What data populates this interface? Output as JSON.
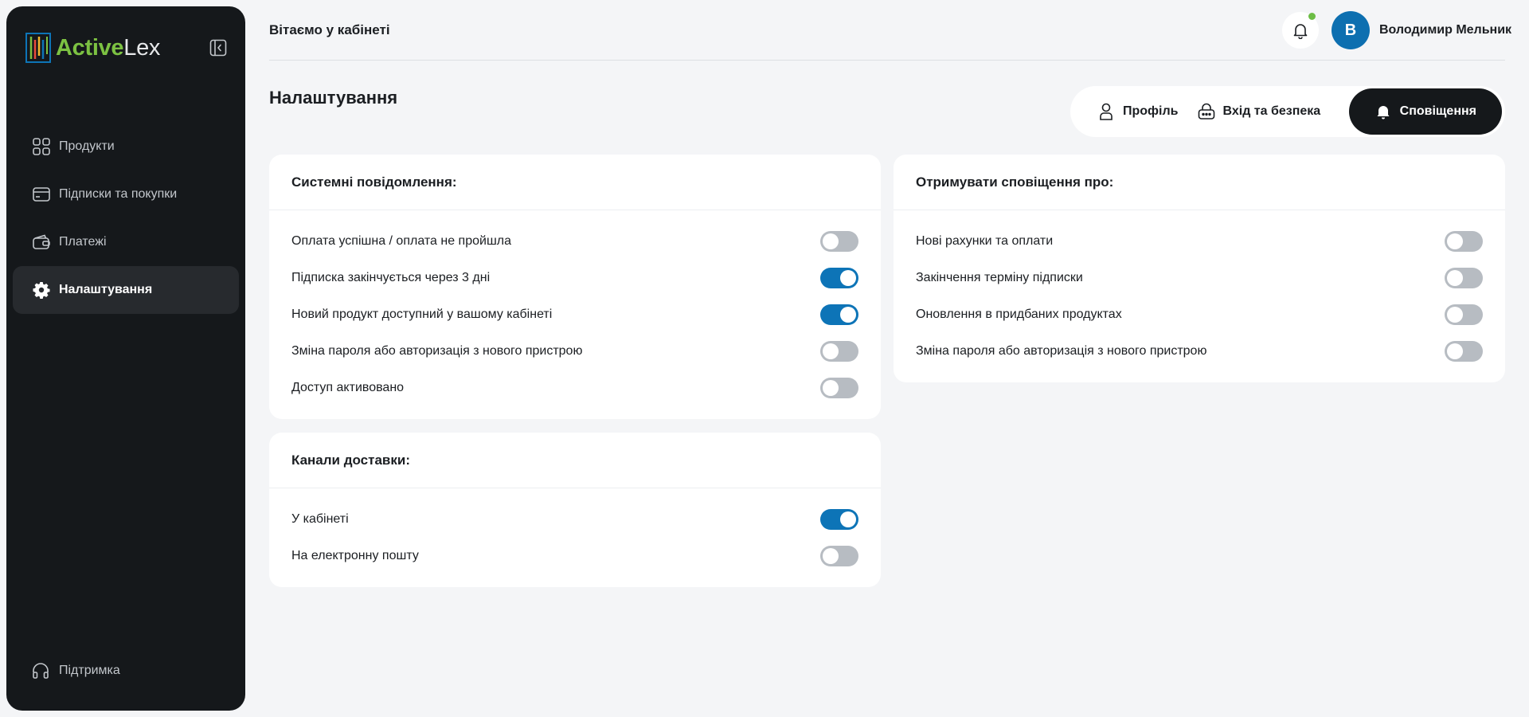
{
  "brand": {
    "name_part1": "Active",
    "name_part2": "Lex"
  },
  "sidebar": {
    "items": [
      {
        "label": "Продукти",
        "icon": "grid-icon"
      },
      {
        "label": "Підписки та покупки",
        "icon": "card-icon"
      },
      {
        "label": "Платежі",
        "icon": "wallet-icon"
      },
      {
        "label": "Налаштування",
        "icon": "gear-icon",
        "active": true
      }
    ],
    "support_label": "Підтримка"
  },
  "header": {
    "welcome": "Вітаємо у кабінеті",
    "avatar_initial": "В",
    "username": "Володимир Мельник",
    "notification_dot": true
  },
  "page": {
    "title": "Налаштування"
  },
  "tabs": [
    {
      "label": "Профіль",
      "icon": "user-icon"
    },
    {
      "label": "Вхід та безпека",
      "icon": "lock-icon"
    },
    {
      "label": "Сповіщення",
      "icon": "bell-icon",
      "active": true
    }
  ],
  "system_notifications": {
    "title": "Системні повідомлення:",
    "items": [
      {
        "label": "Оплата успішна / оплата не пройшла",
        "on": false
      },
      {
        "label": "Підписка закінчується через 3 дні",
        "on": true
      },
      {
        "label": "Новий продукт доступний у вашому кабінеті",
        "on": true
      },
      {
        "label": "Зміна пароля або авторизація з нового пристрою",
        "on": false
      },
      {
        "label": "Доступ активовано",
        "on": false
      }
    ]
  },
  "delivery_channels": {
    "title": "Канали доставки:",
    "items": [
      {
        "label": "У кабінеті",
        "on": true
      },
      {
        "label": "На електронну пошту",
        "on": false
      }
    ]
  },
  "receive_notifications": {
    "title": "Отримувати сповіщення про:",
    "items": [
      {
        "label": "Нові рахунки та оплати",
        "on": false
      },
      {
        "label": "Закінчення терміну підписки",
        "on": false
      },
      {
        "label": "Оновлення в придбаних продуктах",
        "on": false
      },
      {
        "label": "Зміна пароля або авторизація з нового пристрою",
        "on": false
      }
    ]
  },
  "colors": {
    "accent": "#0d74b7",
    "sidebar_bg": "#15181b",
    "brand_green": "#7cc142",
    "online": "#6cbd45"
  }
}
